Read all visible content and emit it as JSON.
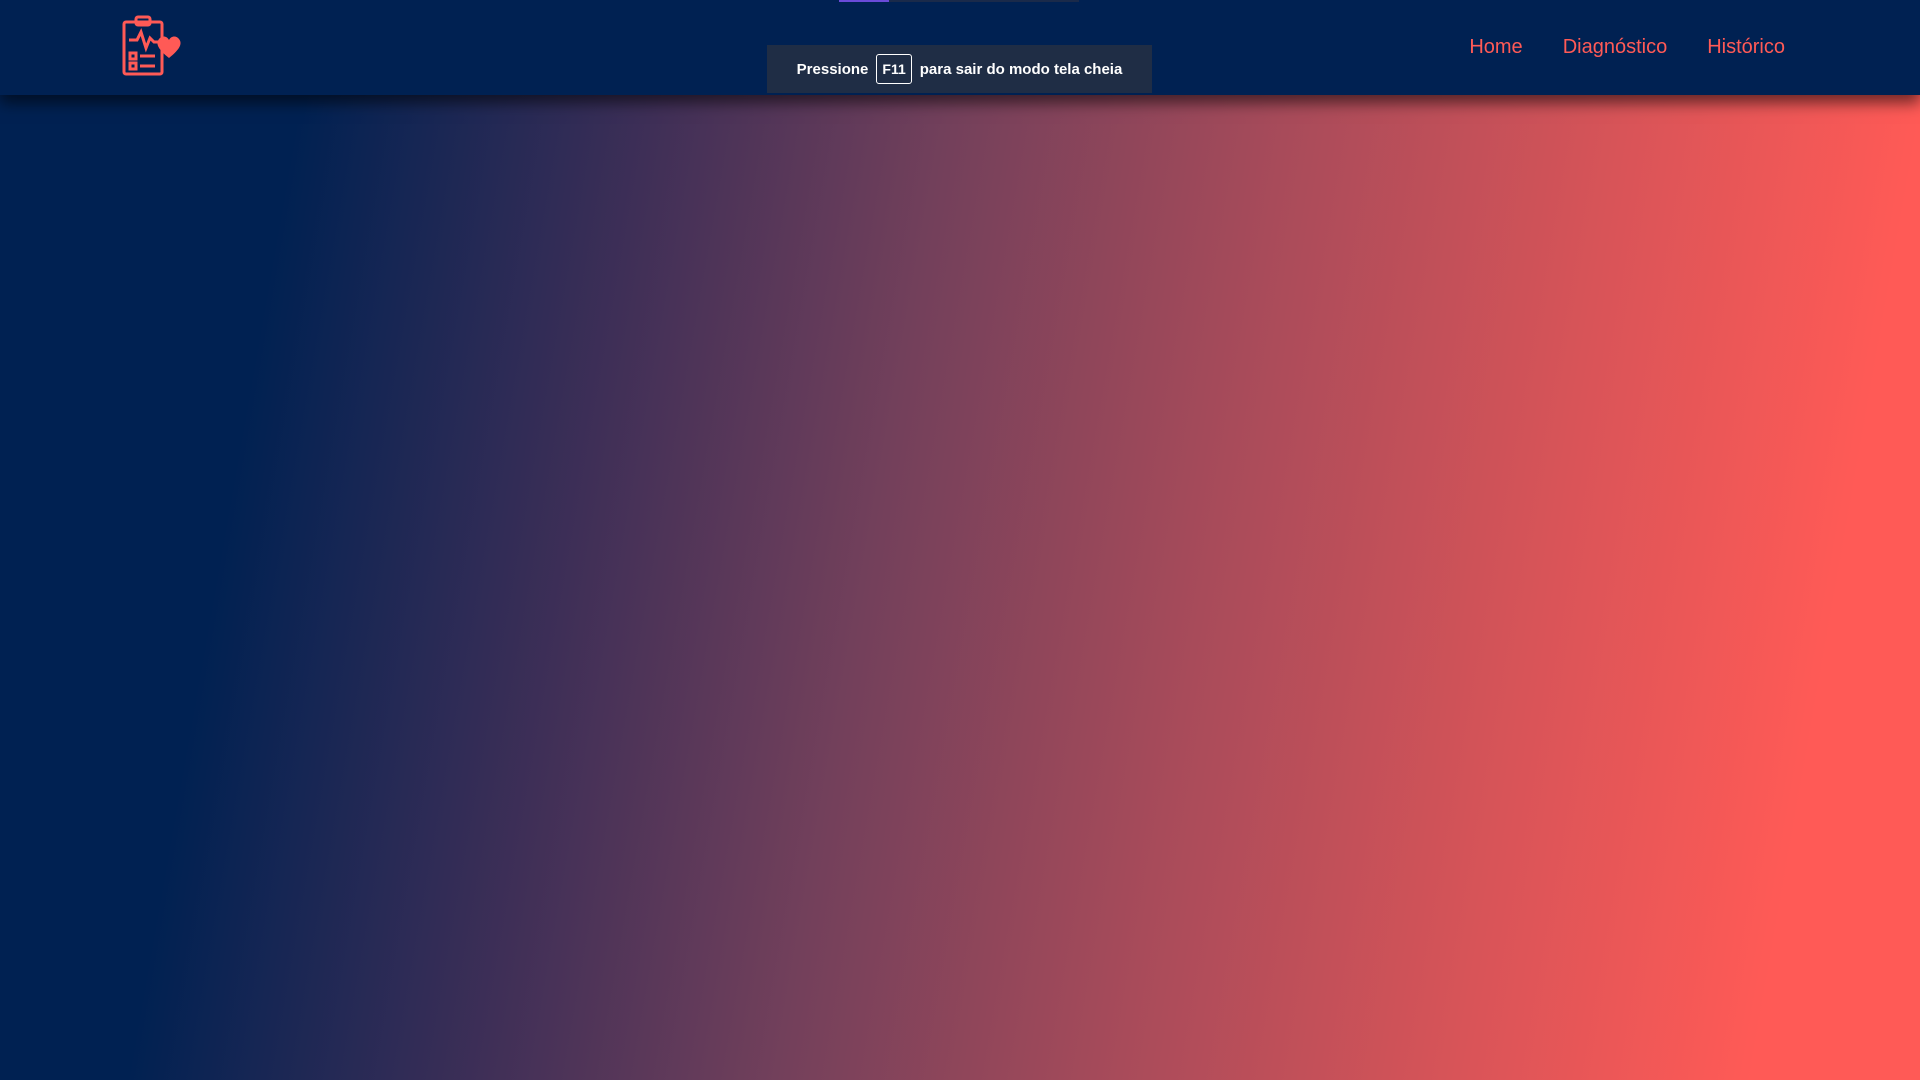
{
  "navbar": {
    "logo_icon": "clipboard-heart-icon",
    "links": [
      {
        "label": "Home"
      },
      {
        "label": "Diagnóstico"
      },
      {
        "label": "Histórico"
      }
    ]
  },
  "fullscreen_notice": {
    "prefix": "Pressione",
    "key": "F11",
    "suffix": "para sair do modo tela cheia"
  },
  "colors": {
    "navbar_bg": "#002152",
    "accent": "#ff5a56",
    "gradient_start": "#002152",
    "gradient_end": "#ff5a56",
    "toast_bg": "#1f2d45"
  }
}
